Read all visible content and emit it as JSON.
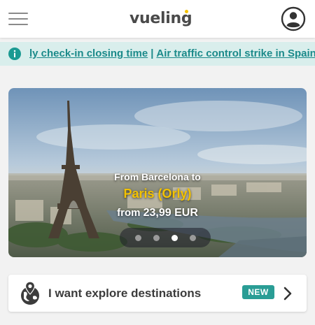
{
  "header": {
    "logo_text": "vueling",
    "brand_accent_color": "#f5c200"
  },
  "notice": {
    "icon": "info-icon",
    "link1": "ly check-in closing time",
    "separator": "|",
    "link2": "Air traffic control strike in Spain"
  },
  "hero": {
    "line1": "From Barcelona to",
    "destination": "Paris (Orly)",
    "from_word": "from",
    "price": "23,99 EUR",
    "slide_count": 4,
    "active_slide": 3
  },
  "explore": {
    "label": "I want explore destinations",
    "badge": "NEW"
  }
}
